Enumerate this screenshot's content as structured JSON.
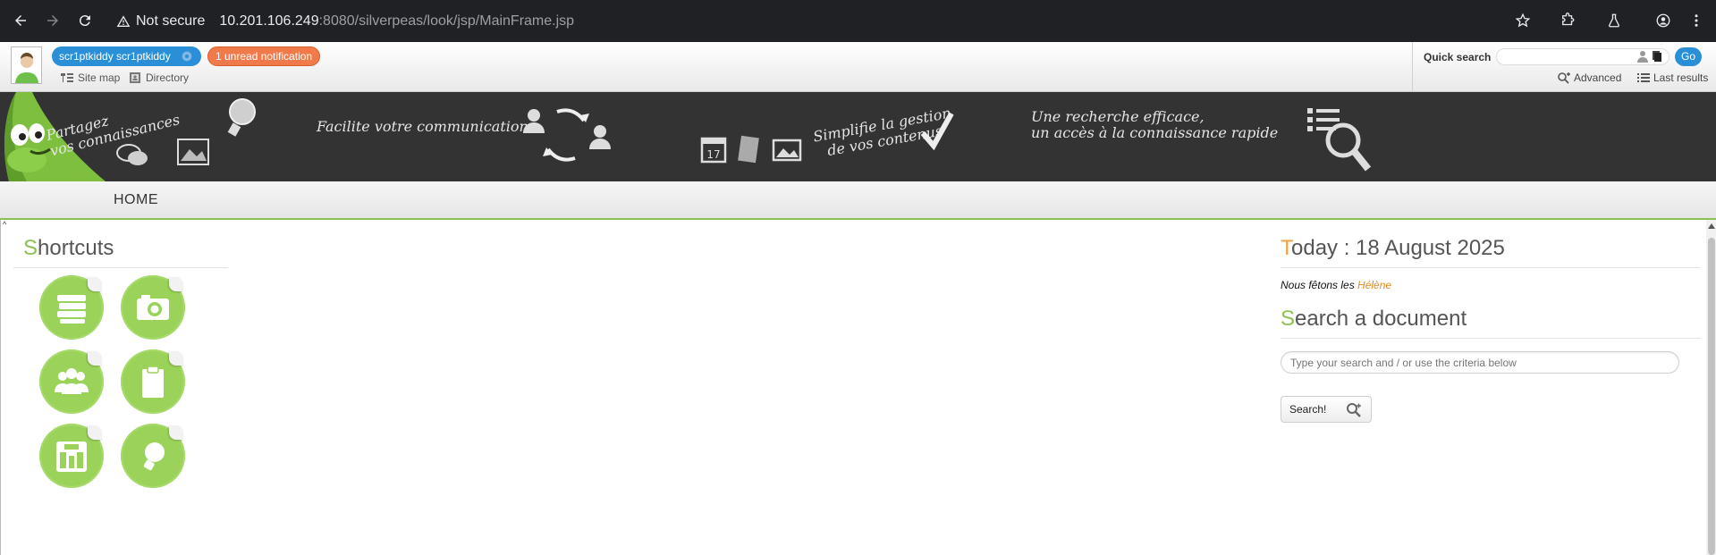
{
  "browser": {
    "security_label": "Not secure",
    "url_host": "10.201.106.249",
    "url_rest": ":8080/silverpeas/look/jsp/MainFrame.jsp"
  },
  "topbar": {
    "user_name": "scr1ptkiddy scr1ptkiddy",
    "notification": "1 unread notification",
    "site_map": "Site map",
    "directory": "Directory"
  },
  "quick_search": {
    "label": "Quick search",
    "placeholder": "",
    "go_label": "Go",
    "advanced": "Advanced",
    "last_results": "Last results"
  },
  "banner": {
    "text1_line1": "Partagez",
    "text1_line2": "vos connaissances",
    "text2": "Facilite votre communication",
    "text3_line1": "Simplifie la gestion",
    "text3_line2": "de vos contenus",
    "text4_line1": "Une recherche efficace,",
    "text4_line2": "un accès à la connaissance rapide",
    "calendar_day": "17"
  },
  "nav": {
    "home": "HOME"
  },
  "shortcuts": {
    "title_first": "S",
    "title_rest": "hortcuts",
    "items": [
      {
        "icon": "books-icon"
      },
      {
        "icon": "camera-icon"
      },
      {
        "icon": "group-icon"
      },
      {
        "icon": "clipboard-icon"
      },
      {
        "icon": "building-icon"
      },
      {
        "icon": "lightbulb-icon"
      }
    ]
  },
  "today": {
    "title_first": "T",
    "title_rest": "oday : 18 August 2025",
    "feast_prefix": "Nous fêtons les ",
    "feast_name": "Hélène"
  },
  "search_document": {
    "title_first": "S",
    "title_rest": "earch a document",
    "placeholder": "Type your search and / or use the criteria below",
    "button": "Search!"
  },
  "colors": {
    "accent_green": "#8cc152",
    "accent_orange": "#f2a03d",
    "link_blue": "#2a8fd6",
    "notification_orange": "#f07a4a",
    "banner_bg": "#333333"
  }
}
